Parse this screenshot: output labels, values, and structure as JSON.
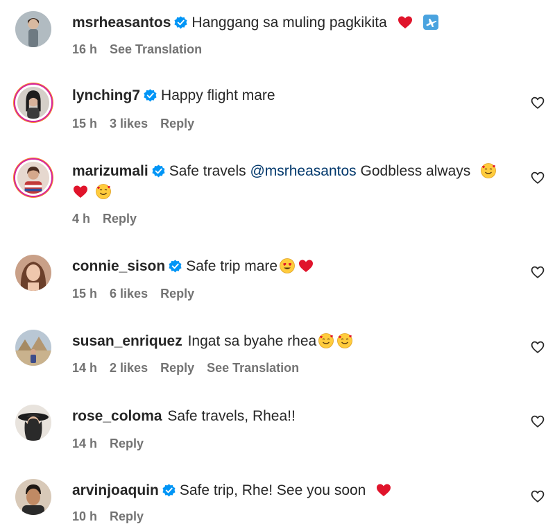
{
  "comments": [
    {
      "username": "msrheasantos",
      "verified": true,
      "text": "Hanggang sa muling pagkikita",
      "emojis": [
        "red-heart",
        "airplane"
      ],
      "time": "16 h",
      "likes": "",
      "reply": "",
      "translation": "See Translation",
      "colors": {
        "avatar_bg": "#9aa5ad"
      }
    },
    {
      "username": "lynching7",
      "verified": true,
      "text": "Happy flight mare",
      "emojis": [],
      "time": "15 h",
      "likes": "3 likes",
      "reply": "Reply",
      "translation": "",
      "colors": {
        "avatar_bg": "#3b3b3b"
      }
    },
    {
      "username": "marizumali",
      "verified": true,
      "text_before": "Safe travels ",
      "mention": "@msrheasantos",
      "text_after": " Godbless always",
      "emojis": [
        "smiling-face-with-hearts",
        "red-heart",
        "smiling-face-with-hearts"
      ],
      "time": "4 h",
      "likes": "",
      "reply": "Reply",
      "translation": "",
      "colors": {
        "avatar_bg": "#c23a3a"
      }
    },
    {
      "username": "connie_sison",
      "verified": true,
      "text": "Safe trip mare",
      "emojis": [
        "heart-eyes",
        "red-heart"
      ],
      "time": "15 h",
      "likes": "6 likes",
      "reply": "Reply",
      "translation": "",
      "colors": {
        "avatar_bg": "#8a5a44"
      }
    },
    {
      "username": "susan_enriquez",
      "verified": false,
      "text": "Ingat sa byahe rhea",
      "emojis": [
        "smiling-face-with-hearts",
        "smiling-face-with-hearts"
      ],
      "time": "14 h",
      "likes": "2 likes",
      "reply": "Reply",
      "translation": "See Translation",
      "colors": {
        "avatar_bg": "#b9c7d4"
      }
    },
    {
      "username": "rose_coloma",
      "verified": false,
      "text": "Safe travels, Rhea!!",
      "emojis": [],
      "time": "14 h",
      "likes": "",
      "reply": "Reply",
      "translation": "",
      "colors": {
        "avatar_bg": "#2a2a2a"
      }
    },
    {
      "username": "arvinjoaquin",
      "verified": true,
      "text": "Safe trip, Rhe! See you soon",
      "emojis": [
        "red-heart"
      ],
      "time": "10 h",
      "likes": "",
      "reply": "Reply",
      "translation": "",
      "colors": {
        "avatar_bg": "#5b4636"
      }
    }
  ],
  "colors": {
    "text": "#262626",
    "meta": "#737373",
    "verified_blue": "#0095f6",
    "mention": "#00376b",
    "heart_red": "#e0142b"
  },
  "icons": {
    "verified": "verified-badge-icon",
    "like": "heart-outline-icon"
  }
}
